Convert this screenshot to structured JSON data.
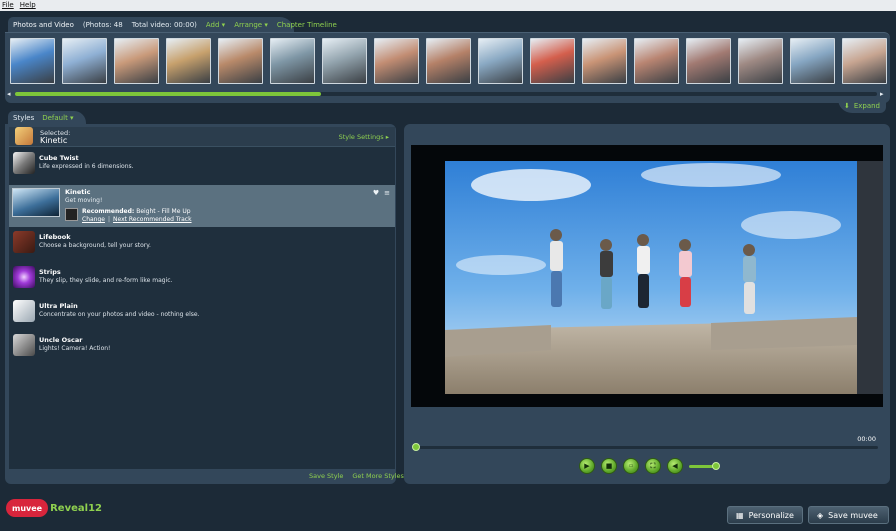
{
  "menu": {
    "file": "File",
    "help": "Help"
  },
  "media": {
    "title": "Photos and Video",
    "counts": "(Photos: 48",
    "total": "Total video: 00:00)",
    "add": "Add",
    "arrange": "Arrange",
    "timeline": "Chapter Timeline",
    "expand": "Expand",
    "thumb_colors": [
      "#4a86c9",
      "#8fb0d4",
      "#c99a7a",
      "#c7a16d",
      "#b98a6a",
      "#7f97a6",
      "#93a4ae",
      "#c28d73",
      "#b58168",
      "#8aa9c3",
      "#d45f4d",
      "#c99476",
      "#b98572",
      "#a27a72",
      "#9f8a84",
      "#86a6c2",
      "#c7a591"
    ],
    "scroll_progress": 0.355
  },
  "styles": {
    "tab": "Styles",
    "filter": "Default",
    "selected_label": "Selected:",
    "selected_name": "Kinetic",
    "settings": "Style Settings",
    "items": [
      {
        "name": "Cube Twist",
        "desc": "Life expressed in 6 dimensions."
      },
      {
        "name": "Lifebook",
        "desc": "Choose a background, tell your story."
      },
      {
        "name": "Strips",
        "desc": "They slip, they slide, and re-form like magic."
      },
      {
        "name": "Ultra Plain",
        "desc": "Concentrate on your photos and video - nothing else."
      },
      {
        "name": "Uncle Oscar",
        "desc": "Lights! Camera! Action!"
      }
    ],
    "kinetic": {
      "name": "Kinetic",
      "desc": "Get moving!",
      "recommended_label": "Recommended:",
      "recommended_track": "Beight - Fill Me Up",
      "change": "Change",
      "next": "Next Recommended Track"
    },
    "save_style": "Save Style",
    "get_more": "Get More Styles"
  },
  "preview": {
    "time": "00:00"
  },
  "brand": {
    "muvee": "muvee",
    "reveal": "Reveal12"
  },
  "buttons": {
    "personalize": "Personalize",
    "save": "Save muvee"
  }
}
